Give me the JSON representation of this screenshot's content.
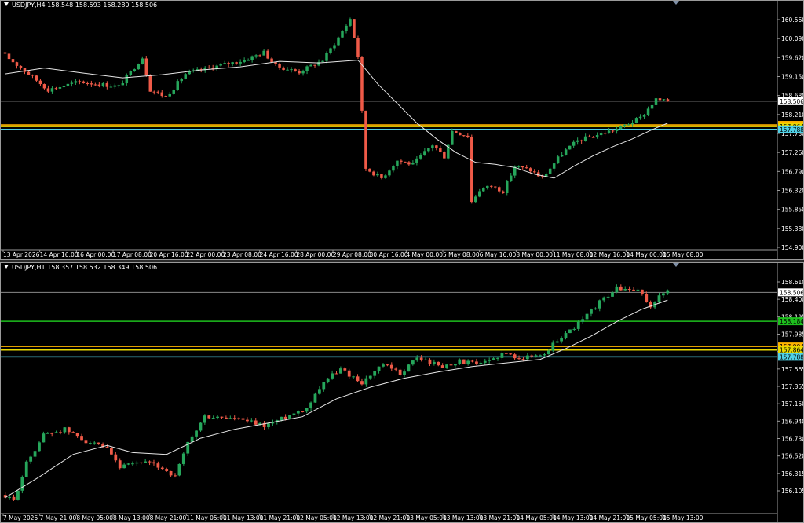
{
  "colors": {
    "background": "#000000",
    "bull": "#26a65b",
    "bear": "#ef5a48",
    "ma": "#e6e6e6",
    "axis_text": "#ffffff",
    "price_line": "#8a8a8a",
    "orange_level": "#ffb400",
    "yellow_level": "#e8d800",
    "cyan_level": "#4fd0e6",
    "green_level": "#1ec01e"
  },
  "chart_data": [
    {
      "type": "candlestick",
      "title": "USDJPY,H4 158.548 158.593 158.280 158.506",
      "ylim": [
        154.75,
        160.78
      ],
      "y_ticks": [
        "160.560",
        "160.090",
        "159.620",
        "159.150",
        "158.680",
        "158.210",
        "157.730",
        "157.260",
        "156.790",
        "156.320",
        "155.850",
        "155.380",
        "154.900"
      ],
      "x_labels": [
        "13 Apr 2026",
        "14 Apr 16:00",
        "16 Apr 00:00",
        "17 Apr 08:00",
        "20 Apr 16:00",
        "22 Apr 00:00",
        "23 Apr 08:00",
        "24 Apr 16:00",
        "28 Apr 00:00",
        "29 Apr 08:00",
        "30 Apr 16:00",
        "4 May 00:00",
        "5 May 08:00",
        "6 May 16:00",
        "8 May 00:00",
        "11 May 08:00",
        "12 May 16:00",
        "14 May 00:00",
        "15 May 08:00"
      ],
      "anchors": [
        [
          0,
          159.75
        ],
        [
          12,
          158.8
        ],
        [
          20,
          159.0
        ],
        [
          30,
          158.88
        ],
        [
          36,
          159.62
        ],
        [
          38,
          158.8
        ],
        [
          42,
          158.62
        ],
        [
          47,
          159.2
        ],
        [
          55,
          159.4
        ],
        [
          62,
          159.55
        ],
        [
          67,
          159.75
        ],
        [
          70,
          159.4
        ],
        [
          76,
          159.25
        ],
        [
          82,
          159.55
        ],
        [
          86,
          160.12
        ],
        [
          89,
          160.6
        ],
        [
          91,
          159.65
        ],
        [
          93,
          156.8
        ],
        [
          97,
          156.55
        ],
        [
          101,
          157.0
        ],
        [
          105,
          156.9
        ],
        [
          110,
          157.4
        ],
        [
          113,
          157.1
        ],
        [
          115,
          157.75
        ],
        [
          119,
          157.62
        ],
        [
          120,
          155.95
        ],
        [
          122,
          156.25
        ],
        [
          125,
          156.35
        ],
        [
          128,
          156.22
        ],
        [
          131,
          156.85
        ],
        [
          135,
          156.75
        ],
        [
          138,
          156.55
        ],
        [
          143,
          157.18
        ],
        [
          147,
          157.5
        ],
        [
          152,
          157.65
        ],
        [
          157,
          157.8
        ],
        [
          163,
          158.08
        ],
        [
          167,
          158.55
        ],
        [
          169,
          158.51
        ]
      ],
      "ma_points": [
        [
          0,
          159.2
        ],
        [
          10,
          159.35
        ],
        [
          20,
          159.22
        ],
        [
          30,
          159.1
        ],
        [
          40,
          159.18
        ],
        [
          50,
          159.3
        ],
        [
          60,
          159.38
        ],
        [
          70,
          159.52
        ],
        [
          80,
          159.48
        ],
        [
          90,
          159.55
        ],
        [
          95,
          158.95
        ],
        [
          100,
          158.45
        ],
        [
          105,
          157.95
        ],
        [
          110,
          157.55
        ],
        [
          115,
          157.2
        ],
        [
          120,
          156.95
        ],
        [
          125,
          156.9
        ],
        [
          130,
          156.82
        ],
        [
          135,
          156.65
        ],
        [
          140,
          156.55
        ],
        [
          145,
          156.85
        ],
        [
          150,
          157.12
        ],
        [
          155,
          157.35
        ],
        [
          160,
          157.55
        ],
        [
          165,
          157.78
        ],
        [
          169,
          157.95
        ]
      ],
      "bar_count": 170,
      "levels": [
        {
          "price": 158.506,
          "label": "158.506",
          "color": "#8a8a8a",
          "text": "#000000",
          "bg": "#ffffff"
        },
        {
          "price": 157.904,
          "label": "157.904",
          "color": "#ffb400",
          "text": "#000000",
          "bg": "#ffb400"
        },
        {
          "price": 157.864,
          "label": "157.864",
          "color": "#e8d800",
          "text": "#000000",
          "bg": "#e8d800"
        },
        {
          "price": 157.788,
          "label": "157.788",
          "color": "#4fd0e6",
          "text": "#000000",
          "bg": "#4fd0e6"
        }
      ]
    },
    {
      "type": "candlestick",
      "title": "USDJPY,H1 158.357 158.532 158.349 158.506",
      "ylim": [
        156.05,
        158.71
      ],
      "y_ticks": [
        "158.610",
        "158.400",
        "158.195",
        "157.985",
        "157.775",
        "157.565",
        "157.355",
        "157.150",
        "156.940",
        "156.730",
        "156.520",
        "156.315",
        "156.105"
      ],
      "x_labels": [
        "7 May 2026",
        "7 May 21:00",
        "8 May 05:00",
        "8 May 13:00",
        "8 May 21:00",
        "11 May 05:00",
        "11 May 13:00",
        "11 May 21:00",
        "12 May 05:00",
        "12 May 13:00",
        "12 May 21:00",
        "13 May 05:00",
        "13 May 13:00",
        "13 May 21:00",
        "14 May 05:00",
        "14 May 13:00",
        "14 May 21:00",
        "15 May 05:00",
        "15 May 13:00"
      ],
      "anchors": [
        [
          0,
          156.25
        ],
        [
          3,
          156.18
        ],
        [
          6,
          156.6
        ],
        [
          10,
          156.92
        ],
        [
          15,
          156.98
        ],
        [
          20,
          156.85
        ],
        [
          25,
          156.75
        ],
        [
          28,
          156.55
        ],
        [
          33,
          156.62
        ],
        [
          38,
          156.55
        ],
        [
          41,
          156.45
        ],
        [
          44,
          156.82
        ],
        [
          48,
          157.12
        ],
        [
          55,
          157.1
        ],
        [
          62,
          157.02
        ],
        [
          67,
          157.12
        ],
        [
          72,
          157.22
        ],
        [
          76,
          157.52
        ],
        [
          80,
          157.65
        ],
        [
          85,
          157.5
        ],
        [
          90,
          157.7
        ],
        [
          94,
          157.6
        ],
        [
          98,
          157.78
        ],
        [
          104,
          157.68
        ],
        [
          108,
          157.74
        ],
        [
          113,
          157.7
        ],
        [
          118,
          157.82
        ],
        [
          123,
          157.78
        ],
        [
          128,
          157.82
        ],
        [
          131,
          157.98
        ],
        [
          134,
          158.08
        ],
        [
          137,
          158.2
        ],
        [
          141,
          158.4
        ],
        [
          145,
          158.55
        ],
        [
          150,
          158.52
        ],
        [
          153,
          158.35
        ],
        [
          156,
          158.51
        ]
      ],
      "ma_points": [
        [
          0,
          156.22
        ],
        [
          8,
          156.45
        ],
        [
          16,
          156.7
        ],
        [
          24,
          156.8
        ],
        [
          30,
          156.72
        ],
        [
          38,
          156.7
        ],
        [
          46,
          156.88
        ],
        [
          54,
          156.98
        ],
        [
          62,
          157.05
        ],
        [
          70,
          157.12
        ],
        [
          78,
          157.32
        ],
        [
          86,
          157.45
        ],
        [
          94,
          157.55
        ],
        [
          102,
          157.62
        ],
        [
          110,
          157.68
        ],
        [
          118,
          157.72
        ],
        [
          126,
          157.76
        ],
        [
          132,
          157.88
        ],
        [
          138,
          158.02
        ],
        [
          144,
          158.18
        ],
        [
          150,
          158.32
        ],
        [
          156,
          158.42
        ]
      ],
      "bar_count": 157,
      "levels": [
        {
          "price": 158.506,
          "label": "158.506",
          "color": "#8a8a8a",
          "text": "#000000",
          "bg": "#ffffff"
        },
        {
          "price": 158.184,
          "label": "158.184",
          "color": "#1ec01e",
          "text": "#000000",
          "bg": "#1ec01e"
        },
        {
          "price": 157.904,
          "label": "157.904",
          "color": "#ffb400",
          "text": "#000000",
          "bg": "#ffb400"
        },
        {
          "price": 157.864,
          "label": "157.864",
          "color": "#e8d800",
          "text": "#000000",
          "bg": "#e8d800"
        },
        {
          "price": 157.788,
          "label": "157.788",
          "color": "#4fd0e6",
          "text": "#000000",
          "bg": "#4fd0e6"
        }
      ]
    }
  ]
}
